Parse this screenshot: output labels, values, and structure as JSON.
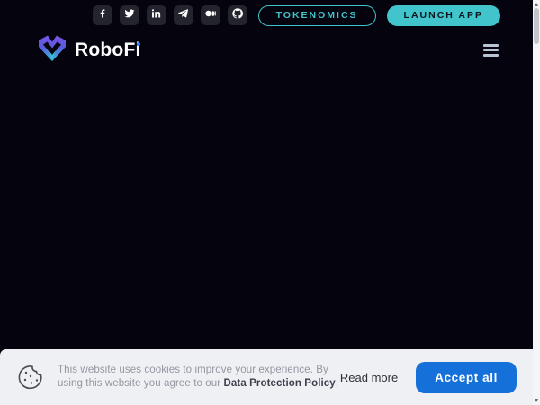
{
  "colors": {
    "page_bg": "#04030e",
    "accent_teal": "#41c4cb",
    "accept_blue": "#1570d9",
    "brand_dot_blue": "#3b7bff",
    "banner_bg": "#eef0f4"
  },
  "topbar": {
    "social": [
      {
        "name": "facebook"
      },
      {
        "name": "twitter"
      },
      {
        "name": "linkedin"
      },
      {
        "name": "telegram"
      },
      {
        "name": "medium"
      },
      {
        "name": "github"
      }
    ],
    "tokenomics_label": "TOKENOMICS",
    "launch_label": "LAUNCH APP"
  },
  "header": {
    "brand": "RoboFi"
  },
  "cookie_banner": {
    "message": "This website uses cookies to improve your experience. By using this website you agree to our ",
    "policy_link": "Data Protection Policy",
    "suffix": ".",
    "read_more_label": "Read more",
    "accept_label": "Accept all"
  }
}
